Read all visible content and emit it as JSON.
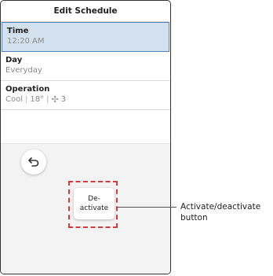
{
  "header": {
    "title": "Edit Schedule"
  },
  "items": {
    "time": {
      "label": "Time",
      "value": "12:20 AM"
    },
    "day": {
      "label": "Day",
      "value": "Everyday"
    },
    "operation": {
      "label": "Operation",
      "mode": "Cool",
      "temp": "18°",
      "fan_level": "3"
    }
  },
  "buttons": {
    "back": {
      "icon": "back-arrow-icon"
    },
    "deactivate": {
      "label": "De-\nactivate"
    }
  },
  "callout": {
    "text": "Activate/deactivate button"
  },
  "colors": {
    "selected_bg": "#d3e1ef",
    "selected_border": "#4f82b8",
    "highlight": "#d63b3b"
  }
}
